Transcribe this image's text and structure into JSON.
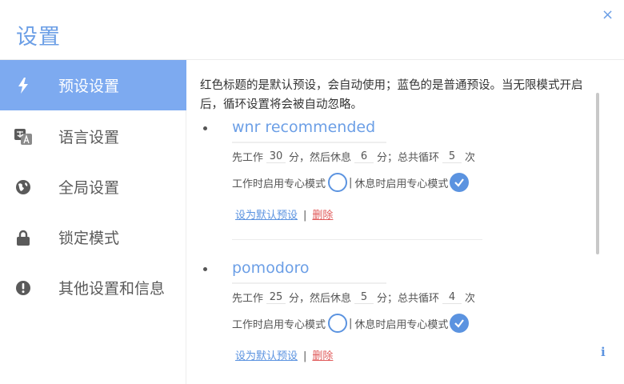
{
  "header": {
    "title": "设置",
    "close_glyph": "×"
  },
  "sidebar": {
    "items": [
      {
        "label": "预设设置",
        "icon": "lightning-icon",
        "active": true
      },
      {
        "label": "语言设置",
        "icon": "translate-icon",
        "active": false
      },
      {
        "label": "全局设置",
        "icon": "globe-icon",
        "active": false
      },
      {
        "label": "锁定模式",
        "icon": "lock-icon",
        "active": false
      },
      {
        "label": "其他设置和信息",
        "icon": "info-circle-icon",
        "active": false
      }
    ]
  },
  "main": {
    "intro": "红色标题的是默认预设，会自动使用；蓝色的是普通预设。当无限模式开启后，循环设置将会被自动忽略。",
    "presets": [
      {
        "name": "wnr recommended",
        "text_work_prefix": "先工作",
        "work": "30",
        "text_minutes_then_rest": "分，然后休息",
        "rest": "6",
        "text_minutes_total_loop": "分；总共循环",
        "loop": "5",
        "text_times": "次",
        "focus_work_label": "工作时启用专心模式",
        "focus_work_checked": false,
        "divider_text": "|",
        "focus_rest_label": "休息时启用专心模式",
        "focus_rest_checked": true,
        "set_default_label": "设为默认预设",
        "link_separator": "|",
        "delete_label": "删除"
      },
      {
        "name": "pomodoro",
        "text_work_prefix": "先工作",
        "work": "25",
        "text_minutes_then_rest": "分，然后休息",
        "rest": "5",
        "text_minutes_total_loop": "分；总共循环",
        "loop": "4",
        "text_times": "次",
        "focus_work_label": "工作时启用专心模式",
        "focus_work_checked": false,
        "divider_text": "|",
        "focus_rest_label": "休息时启用专心模式",
        "focus_rest_checked": true,
        "set_default_label": "设为默认预设",
        "link_separator": "|",
        "delete_label": "删除"
      }
    ],
    "info_glyph": "i"
  },
  "colors": {
    "accent": "#6c9fe6",
    "sidebar_active": "#7daaf0",
    "delete": "#e05a5a"
  }
}
